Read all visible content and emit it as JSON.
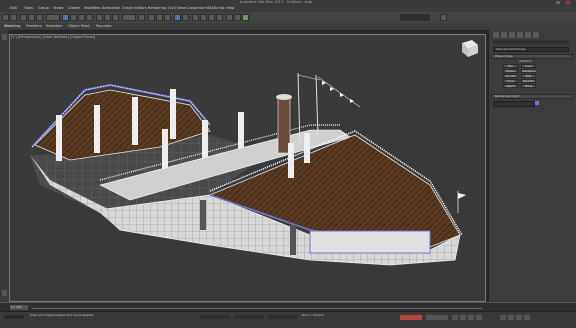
{
  "window": {
    "title": "Autodesk 3ds Max 2015 - Untitled - ship"
  },
  "menu": [
    "Edit",
    "Tools",
    "Group",
    "Views",
    "Create",
    "Modifiers",
    "Animation",
    "Graph Editors",
    "Rendering",
    "Civil View",
    "Customize",
    "MAXScript",
    "Help"
  ],
  "ribbon": {
    "tabs": [
      "Modeling",
      "Freeform",
      "Selection",
      "Object Paint",
      "Populate"
    ]
  },
  "viewport": {
    "label": "[+] [Perspective] [User Defined] [Edged Faces]"
  },
  "command_panel": {
    "dropdown": "Standard Primitives",
    "object_type_header": "Object Type",
    "autogrid": "AutoGrid",
    "buttons": [
      "Box",
      "Cone",
      "Sphere",
      "GeoSphere",
      "Cylinder",
      "Tube",
      "Torus",
      "Pyramid",
      "Teapot",
      "Plane"
    ],
    "name_color_header": "Name and Color"
  },
  "timeline": {
    "frame": "0 / 100"
  },
  "status": {
    "text": "Click and drag to select and move objects",
    "grid": "Grid = 10.0cm"
  },
  "colors": {
    "deck": "#5a3b22",
    "wire": "#e6e6e6",
    "accent": "#6f78d8"
  }
}
